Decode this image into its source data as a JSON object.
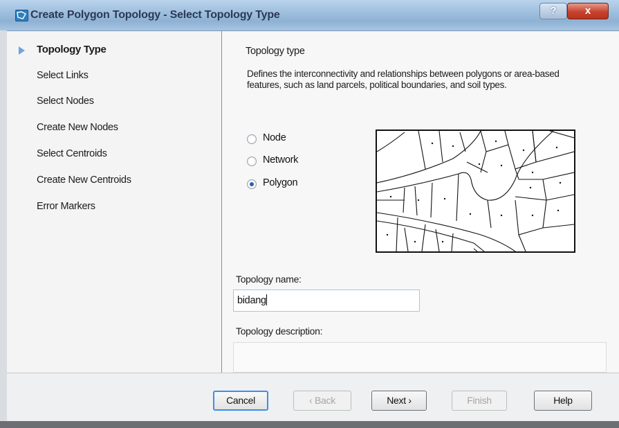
{
  "window": {
    "title": "Create Polygon Topology - Select Topology Type",
    "help_label": "?",
    "close_label": "x"
  },
  "nav": {
    "items": [
      {
        "label": "Topology Type",
        "active": true
      },
      {
        "label": "Select Links"
      },
      {
        "label": "Select Nodes"
      },
      {
        "label": "Create New Nodes"
      },
      {
        "label": "Select Centroids"
      },
      {
        "label": "Create New Centroids"
      },
      {
        "label": "Error Markers"
      }
    ]
  },
  "main": {
    "section_title": "Topology type",
    "description": "Defines the interconnectivity and relationships between polygons or area-based features, such as land parcels, political boundaries, and soil types.",
    "options": [
      {
        "label": "Node",
        "checked": false
      },
      {
        "label": "Network",
        "checked": false
      },
      {
        "label": "Polygon",
        "checked": true
      }
    ],
    "name_label": "Topology name:",
    "name_value": "bidang",
    "description_label": "Topology description:",
    "description_value": ""
  },
  "footer": {
    "cancel": "Cancel",
    "back": "‹ Back",
    "next": "Next ›",
    "finish": "Finish",
    "help": "Help"
  },
  "colors": {
    "titlebar": "#9cbddd",
    "close": "#c8432d",
    "accent": "#3d8ee6",
    "nav_arrow": "#6fa3e0"
  }
}
